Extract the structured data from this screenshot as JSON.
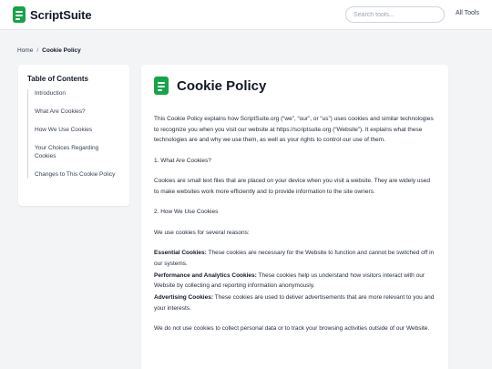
{
  "header": {
    "logo_text": "ScriptSuite",
    "logo_icon": "document-icon",
    "search_placeholder": "Search tools...",
    "all_tools_label": "All Tools"
  },
  "breadcrumb": {
    "home": "Home",
    "separator": "/",
    "current": "Cookie Policy"
  },
  "toc": {
    "title": "Table of Contents",
    "items": [
      {
        "label": "Introduction"
      },
      {
        "label": "What Are Cookies?"
      },
      {
        "label": "How We Use Cookies"
      },
      {
        "label": "Your Choices Regarding Cookies"
      },
      {
        "label": "Changes to This Cookie Policy"
      }
    ]
  },
  "main": {
    "icon": "document-icon",
    "title": "Cookie Policy",
    "intro": "This Cookie Policy explains how ScriptSuite.org (“we”, “our”, or “us”) uses cookies and similar technologies to recognize you when you visit our website at https://scriptsuite.org (“Website”). It explains what these technologies are and why we use them, as well as your rights to control our use of them.",
    "section1_heading": "1. What Are Cookies?",
    "section1_text": "Cookies are small text files that are placed on your device when you visit a website. They are widely used to make websites work more efficiently and to provide information to the site owners.",
    "section2_heading": "2. How We Use Cookies",
    "section2_lead": "We use cookies for several reasons:",
    "cookie_types": [
      {
        "name": "Essential Cookies:",
        "text": " These cookies are necessary for the Website to function and cannot be switched off in our systems."
      },
      {
        "name": "Performance and Analytics Cookies:",
        "text": " These cookies help us understand how visitors interact with our Website by collecting and reporting information anonymously."
      },
      {
        "name": "Advertising Cookies:",
        "text": " These cookies are used to deliver advertisements that are more relevant to you and your interests."
      }
    ],
    "closing": "We do not use cookies to collect personal data or to track your browsing activities outside of our Website."
  },
  "colors": {
    "brand": "#16a34a",
    "page_bg": "#f3f4f6",
    "card_bg": "#ffffff"
  }
}
